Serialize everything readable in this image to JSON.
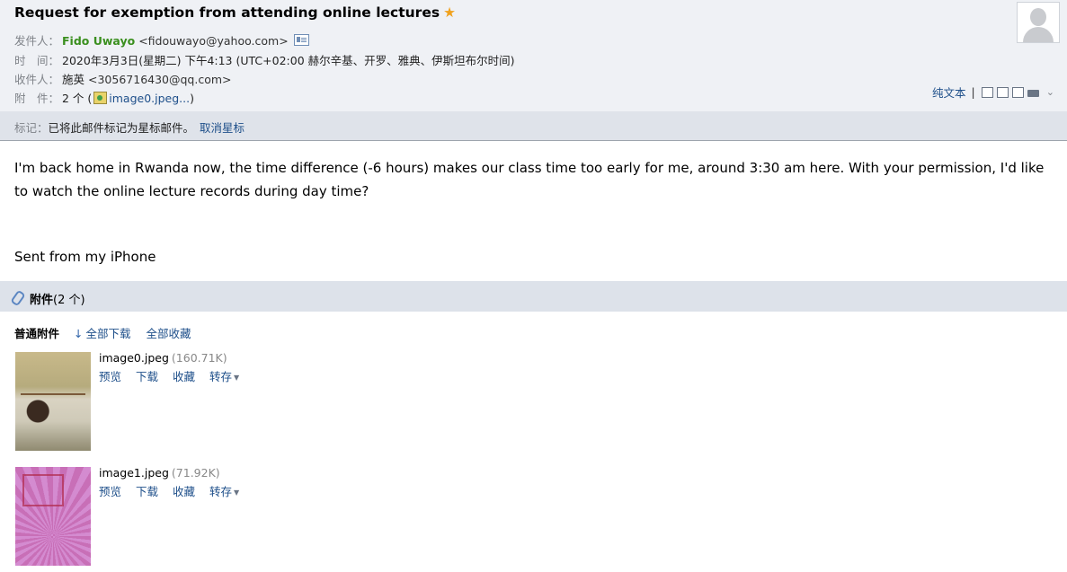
{
  "email": {
    "subject": "Request for exemption from attending online lectures",
    "star_icon": "★",
    "from": {
      "label": "发件人：",
      "name": "Fido Uwayo",
      "address": "<fidouwayo@yahoo.com>"
    },
    "time": {
      "label": "时　间：",
      "value": "2020年3月3日(星期二) 下午4:13 (UTC+02:00 赫尔辛基、开罗、雅典、伊斯坦布尔时间)"
    },
    "to": {
      "label": "收件人：",
      "name": "施英",
      "address": "<3056716430@qq.com>"
    },
    "attachments_summary": {
      "label": "附　件：",
      "count": "2 个 (",
      "first_file": "image0.jpeg...",
      "close_paren": ")"
    }
  },
  "toolbar": {
    "plain_text": "纯文本",
    "separator": "|",
    "chevron": "⌄"
  },
  "flag_bar": {
    "label": "标记：",
    "text": "已将此邮件标记为星标邮件。",
    "cancel_link": "取消星标"
  },
  "body": {
    "paragraph": "I'm back home in Rwanda now, the time difference (-6 hours) makes our class time too early for me, around 3:30 am here. With your permission, I'd like to watch the online lecture records during day time?",
    "signature": "Sent from my iPhone"
  },
  "attachments": {
    "title": "附件",
    "count": "(2 个)",
    "kind_label": "普通附件",
    "download_all_arrow": "↓",
    "download_all": "全部下载",
    "save_all": "全部收藏",
    "files": [
      {
        "name": "image0.jpeg",
        "size": "(160.71K)",
        "preview": "预览",
        "download": "下载",
        "favorite": "收藏",
        "save_to": "转存",
        "caret": "▼"
      },
      {
        "name": "image1.jpeg",
        "size": "(71.92K)",
        "preview": "预览",
        "download": "下载",
        "favorite": "收藏",
        "save_to": "转存",
        "caret": "▼"
      }
    ]
  }
}
